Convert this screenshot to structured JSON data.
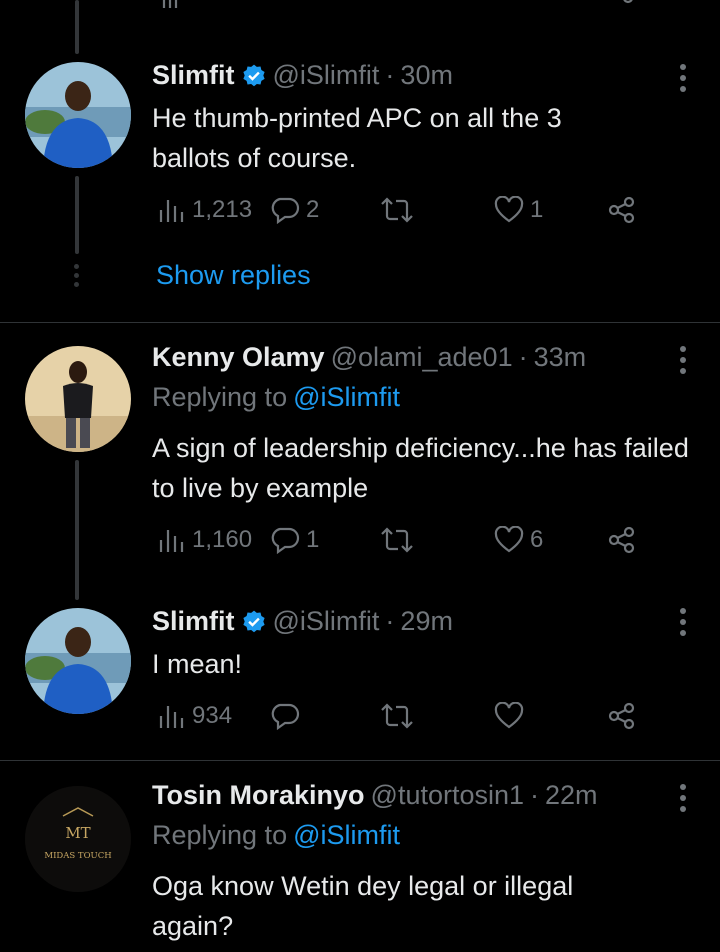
{
  "tweets": [
    {
      "name": "Slimfit",
      "handle": "@iSlimfit",
      "sep": "·",
      "time": "30m",
      "verified": true,
      "body": "He thumb-printed APC on all the 3 ballots of course.",
      "views": "1,213",
      "replies": "2",
      "retweets": "",
      "likes": "1"
    },
    {
      "name": "Kenny Olamy",
      "handle": "@olami_ade01",
      "sep": "·",
      "time": "33m",
      "verified": false,
      "replying_label": "Replying to",
      "replying_to": "@iSlimfit",
      "body": "A sign of leadership deficiency...he has failed to live by example",
      "views": "1,160",
      "replies": "1",
      "retweets": "",
      "likes": "6"
    },
    {
      "name": "Slimfit",
      "handle": "@iSlimfit",
      "sep": "·",
      "time": "29m",
      "verified": true,
      "body": "I mean!",
      "views": "934",
      "replies": "",
      "retweets": "",
      "likes": ""
    },
    {
      "name": "Tosin Morakinyo",
      "handle": "@tutortosin1",
      "sep": "·",
      "time": "22m",
      "verified": false,
      "replying_label": "Replying to",
      "replying_to": "@iSlimfit",
      "body": "Oga know Wetin dey legal or illegal again?",
      "avatar_logo_line1": "MT",
      "avatar_logo_line2": "MIDAS TOUCH"
    }
  ],
  "show_replies": "Show replies",
  "colors": {
    "accent": "#1d9bf0",
    "muted": "#71767b",
    "text": "#e7e9ea",
    "background": "#000000"
  }
}
